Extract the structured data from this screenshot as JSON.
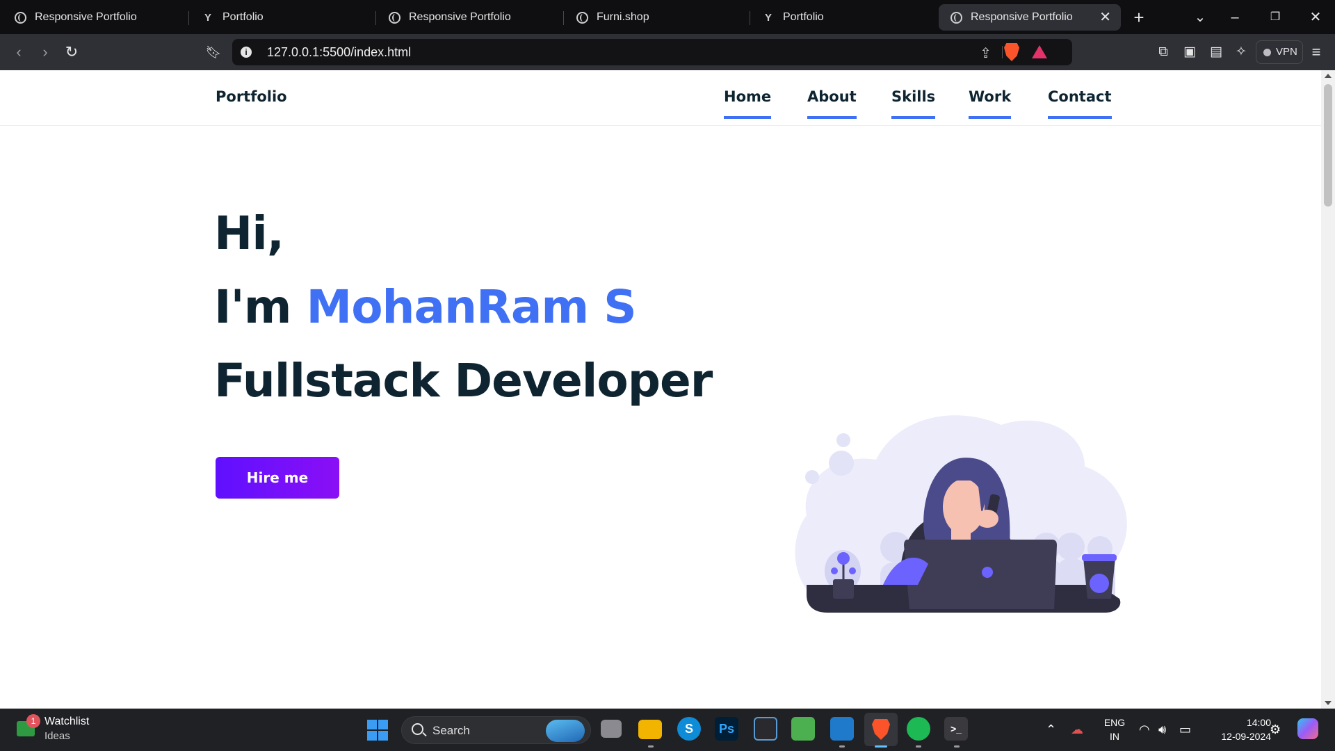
{
  "browser": {
    "tabs": [
      {
        "title": "Responsive Portfolio",
        "icon": "globe-icon"
      },
      {
        "title": "Portfolio",
        "icon": "y-icon"
      },
      {
        "title": "Responsive Portfolio",
        "icon": "globe-icon"
      },
      {
        "title": "Furni.shop",
        "icon": "globe-icon"
      },
      {
        "title": "Portfolio",
        "icon": "y-icon"
      },
      {
        "title": "Responsive Portfolio",
        "icon": "globe-icon",
        "active": true
      }
    ],
    "favicon_y": "Y",
    "new_tab_glyph": "+",
    "close_glyph": "✕",
    "url": "127.0.0.1:5500/index.html",
    "vpn_label": "VPN"
  },
  "site": {
    "logo": "Portfolio",
    "nav": [
      "Home",
      "About",
      "Skills",
      "Work",
      "Contact"
    ],
    "nav_underline_color": "#4070f4",
    "hero": {
      "line1": "Hi,",
      "line2_prefix": "I'm ",
      "name": "MohanRam S",
      "line3": "Fullstack Developer",
      "button": "Hire me"
    },
    "colors": {
      "text": "#0e2431",
      "accent": "#4070f4",
      "button": "#6c16ff"
    }
  },
  "taskbar": {
    "widget_title": "Watchlist",
    "widget_subtitle": "Ideas",
    "widget_badge": "1",
    "search_label": "Search",
    "apps": [
      "task-view-icon",
      "file-explorer-icon",
      "skype-icon",
      "photoshop-icon",
      "microsoft-store-icon",
      "image-editor-icon",
      "vscode-icon",
      "brave-icon",
      "spotify-icon",
      "terminal-icon"
    ],
    "app_glyphs": {
      "skype": "S",
      "photoshop": "Ps"
    },
    "lang_top": "ENG",
    "lang_bottom": "IN",
    "time": "14:00",
    "date": "12-09-2024"
  }
}
